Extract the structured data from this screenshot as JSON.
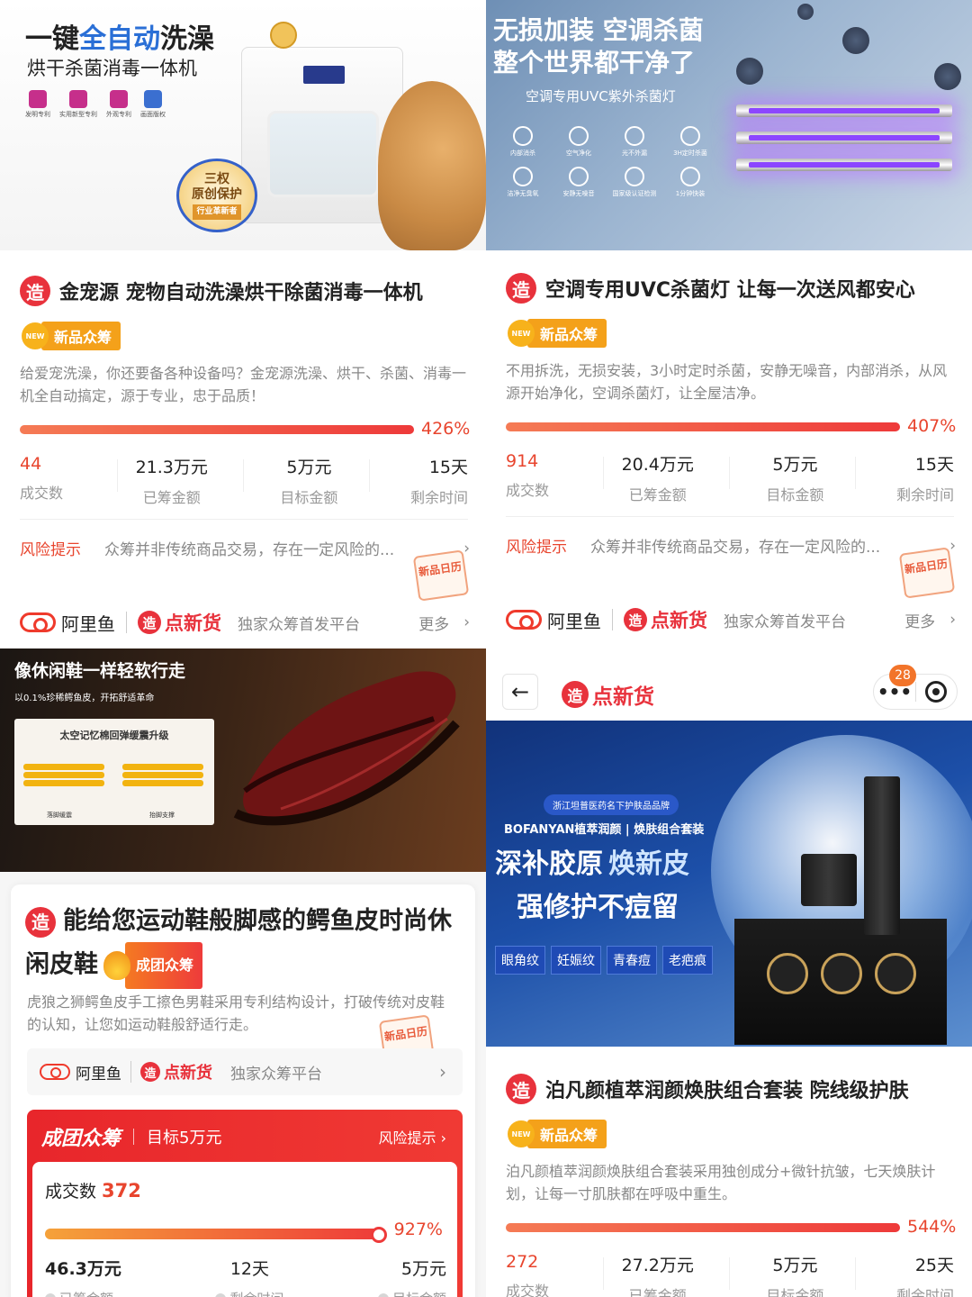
{
  "p1": {
    "hero_title_a": "一键",
    "hero_title_b": "全自动",
    "hero_title_c": "洗澡",
    "hero_sub": "烘干杀菌消毒一体机",
    "patents": [
      "发明专利",
      "实用新型专利",
      "外观专利",
      "画面版权"
    ],
    "seal_a": "三权",
    "seal_b": "原创保护",
    "seal_c": "行业革新者",
    "title": "金宠源 宠物自动洗澡烘干除菌消毒一体机",
    "badge": "新品众筹",
    "badge_new": "NEW",
    "desc": "给爱宠洗澡，你还要备各种设备吗？金宠源洗澡、烘干、杀菌、消毒一机全自动搞定，源于专业，忠于品质！",
    "percent": "426%",
    "progress": 1.0,
    "stats": [
      {
        "value": "44",
        "label": "成交数"
      },
      {
        "value": "21.3万元",
        "label": "已筹金额"
      },
      {
        "value": "5万元",
        "label": "目标金额"
      },
      {
        "value": "15天",
        "label": "剩余时间"
      }
    ],
    "risk_label": "风险提示",
    "risk_text": "众筹并非传统商品交易，存在一定风险的...",
    "calendar": "新品日历",
    "brand_ali": "阿里鱼",
    "brand_dxh": "点新货",
    "platform": "独家众筹首发平台",
    "more": "更多"
  },
  "p2": {
    "hero_title_1": "无损加装 空调杀菌",
    "hero_title_2": "整个世界都干净了",
    "hero_sub": "空调专用UVC紫外杀菌灯",
    "icons": [
      "内部消杀",
      "空气净化",
      "光不外漏",
      "3H定时杀菌",
      "洁净无臭氧",
      "安静无噪音",
      "国家级认证检测",
      "1分钟快装"
    ],
    "title": "空调专用UVC杀菌灯 让每一次送风都安心",
    "badge": "新品众筹",
    "badge_new": "NEW",
    "desc": "不用拆洗，无损安装，3小时定时杀菌，安静无噪音，内部消杀，从风源开始净化，空调杀菌灯，让全屋洁净。",
    "percent": "407%",
    "progress": 1.0,
    "stats": [
      {
        "value": "914",
        "label": "成交数"
      },
      {
        "value": "20.4万元",
        "label": "已筹金额"
      },
      {
        "value": "5万元",
        "label": "目标金额"
      },
      {
        "value": "15天",
        "label": "剩余时间"
      }
    ],
    "risk_label": "风险提示",
    "risk_text": "众筹并非传统商品交易，存在一定风险的...",
    "calendar": "新品日历",
    "brand_ali": "阿里鱼",
    "brand_dxh": "点新货",
    "platform": "独家众筹首发平台",
    "more": "更多"
  },
  "p3": {
    "hero_title": "像休闲鞋一样轻软行走",
    "hero_sub": "以0.1%珍稀鳄鱼皮，开拓舒适革命",
    "card_title": "太空记忆棉回弹缓震升级",
    "card_left": "落脚缓震",
    "card_right": "抬脚支撑",
    "title": "能给您运动鞋般脚感的鳄鱼皮时尚休闲皮鞋",
    "badge": "成团众筹",
    "desc": "虎狼之狮鳄鱼皮手工擦色男鞋采用专利结构设计，打破传统对皮鞋的认知，让您如运动鞋般舒适行走。",
    "calendar": "新品日历",
    "brand_ali": "阿里鱼",
    "brand_dxh": "点新货",
    "platform": "独家众筹平台",
    "red_title": "成团众筹",
    "red_target": "目标5万元",
    "red_risk": "风险提示",
    "count_label": "成交数",
    "count_value": "372",
    "percent": "927%",
    "progress": 1.0,
    "stats": [
      {
        "value": "46.3万元",
        "label": "已筹金额"
      },
      {
        "value": "12天",
        "label": "剩余时间"
      },
      {
        "value": "5万元",
        "label": "目标金额"
      }
    ]
  },
  "p4": {
    "nav_brand": "点新货",
    "notif_count": "28",
    "hero_small": "浙江坦普医药名下护肤品品牌",
    "hero_brand": "BOFANYAN植萃润颜 | 焕肤组合套装",
    "hero_big_a": "深补胶原",
    "hero_big_b": "焕新皮",
    "hero_big_c": "强修护不痘留",
    "tags": [
      "眼角纹",
      "妊娠纹",
      "青春痘",
      "老疤痕"
    ],
    "title": "泊凡颜植萃润颜焕肤组合套装 院线级护肤",
    "badge": "新品众筹",
    "badge_new": "NEW",
    "desc": "泊凡颜植萃润颜焕肤组合套装采用独创成分+微针抗皱，七天焕肤计划，让每一寸肌肤都在呼吸中重生。",
    "percent": "544%",
    "progress": 1.0,
    "stats": [
      {
        "value": "272",
        "label": "成交数"
      },
      {
        "value": "27.2万元",
        "label": "已筹金额"
      },
      {
        "value": "5万元",
        "label": "目标金额"
      },
      {
        "value": "25天",
        "label": "剩余时间"
      }
    ]
  },
  "common": {
    "zao": "造",
    "arrow": "›",
    "back": "←",
    "dots": "•••"
  },
  "colors": {
    "accent": "#e8452e",
    "badge_orange": "#f4a11a",
    "brand_red": "#e8323c"
  }
}
